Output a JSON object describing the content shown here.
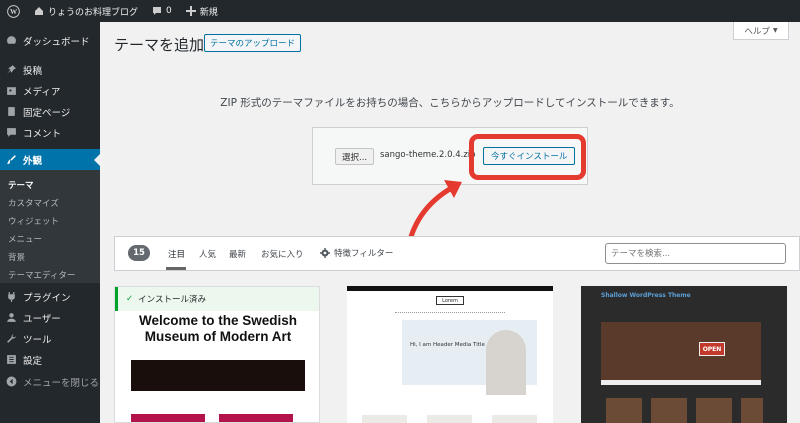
{
  "adminbar": {
    "site_name": "りょうのお料理ブログ",
    "comments_count": "0",
    "new_label": "新規"
  },
  "sidebar": {
    "items": [
      {
        "label": "ダッシュボード",
        "icon": "dashboard-icon"
      },
      {
        "label": "投稿",
        "icon": "pin-icon"
      },
      {
        "label": "メディア",
        "icon": "media-icon"
      },
      {
        "label": "固定ページ",
        "icon": "page-icon"
      },
      {
        "label": "コメント",
        "icon": "comment-icon"
      },
      {
        "label": "外観",
        "icon": "brush-icon"
      },
      {
        "label": "プラグイン",
        "icon": "plugin-icon"
      },
      {
        "label": "ユーザー",
        "icon": "user-icon"
      },
      {
        "label": "ツール",
        "icon": "wrench-icon"
      },
      {
        "label": "設定",
        "icon": "settings-icon"
      },
      {
        "label": "メニューを閉じる",
        "icon": "collapse-icon"
      }
    ],
    "submenu": [
      "テーマ",
      "カスタマイズ",
      "ウィジェット",
      "メニュー",
      "背景",
      "テーマエディター"
    ]
  },
  "page": {
    "title": "テーマを追加",
    "upload_button": "テーマのアップロード",
    "help": "ヘルプ"
  },
  "upload": {
    "description": "ZIP 形式のテーマファイルをお持ちの場合、こちらからアップロードしてインストールできます。",
    "choose_button": "選択...",
    "file_name": "sango-theme.2.0.4.zip",
    "install_button": "今すぐインストール"
  },
  "filter": {
    "count": "15",
    "tabs": [
      "注目",
      "人気",
      "最新",
      "お気に入り"
    ],
    "feature_filter": "特徴フィルター",
    "search_placeholder": "テーマを検索..."
  },
  "themes": {
    "card1": {
      "installed": "インストール済み",
      "title_line1": "Welcome to the Swedish",
      "title_line2": "Museum of Modern Art"
    },
    "card2": {
      "logo": "Lorem",
      "hero_title": "Hi, I am Header Media Title"
    },
    "card3": {
      "title": "Shallow WordPress Theme",
      "sign": "OPEN"
    }
  },
  "colors": {
    "adminbar_bg": "#23282d",
    "accent": "#0073aa",
    "highlight": "#e53a2f"
  }
}
